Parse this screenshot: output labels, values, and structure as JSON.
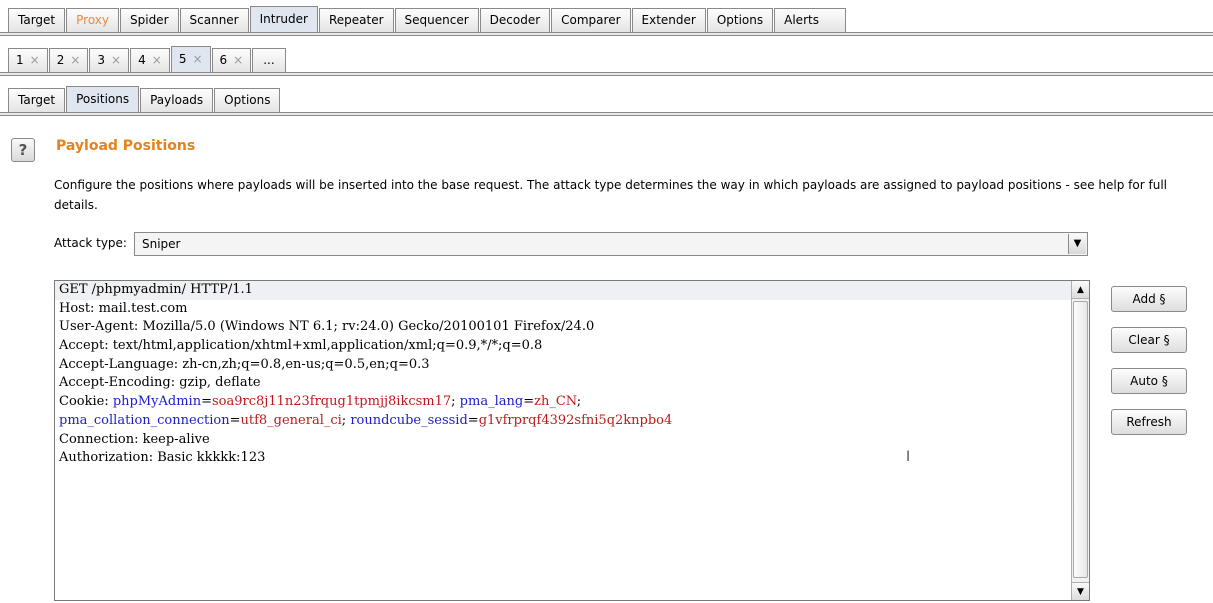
{
  "main_tabs": [
    {
      "label": "Target"
    },
    {
      "label": "Proxy"
    },
    {
      "label": "Spider"
    },
    {
      "label": "Scanner"
    },
    {
      "label": "Intruder"
    },
    {
      "label": "Repeater"
    },
    {
      "label": "Sequencer"
    },
    {
      "label": "Decoder"
    },
    {
      "label": "Comparer"
    },
    {
      "label": "Extender"
    },
    {
      "label": "Options"
    },
    {
      "label": "Alerts"
    }
  ],
  "attack_tabs": [
    {
      "label": "1",
      "close": "×"
    },
    {
      "label": "2",
      "close": "×"
    },
    {
      "label": "3",
      "close": "×"
    },
    {
      "label": "4",
      "close": "×"
    },
    {
      "label": "5",
      "close": "×"
    },
    {
      "label": "6",
      "close": "×"
    },
    {
      "label": "..."
    }
  ],
  "sub_tabs": [
    {
      "label": "Target"
    },
    {
      "label": "Positions"
    },
    {
      "label": "Payloads"
    },
    {
      "label": "Options"
    }
  ],
  "help_icon": "?",
  "section": {
    "title": "Payload Positions",
    "description": "Configure the positions where payloads will be inserted into the base request. The attack type determines the way in which payloads are assigned to payload positions - see help for full details."
  },
  "attack_type": {
    "label": "Attack type:",
    "value": "Sniper"
  },
  "request": {
    "line1": "GET /phpmyadmin/ HTTP/1.1",
    "line2": "Host: mail.test.com",
    "line3": "User-Agent: Mozilla/5.0 (Windows NT 6.1; rv:24.0) Gecko/20100101 Firefox/24.0",
    "line4": "Accept: text/html,application/xhtml+xml,application/xml;q=0.9,*/*;q=0.8",
    "line5": "Accept-Language: zh-cn,zh;q=0.8,en-us;q=0.5,en;q=0.3",
    "line6": "Accept-Encoding: gzip, deflate",
    "cookie_prefix": "Cookie: ",
    "cookie1_name": "phpMyAdmin",
    "cookie1_value": "soa9rc8j11n23frqug1tpmjj8ikcsm17",
    "cookie2_name": "pma_lang",
    "cookie2_value": "zh_CN",
    "cookie3_name": "pma_collation_connection",
    "cookie3_value": "utf8_general_ci",
    "cookie4_name": "roundcube_sessid",
    "cookie4_value": "g1vfrprqf4392sfni5q2knpbo4",
    "line9": "Connection: keep-alive",
    "line10": "Authorization: Basic kkkkk:123"
  },
  "buttons": {
    "add": "Add §",
    "clear": "Clear §",
    "auto": "Auto §",
    "refresh": "Refresh"
  },
  "colors": {
    "accent": "#e5821d",
    "param_name": "#1c1cd0",
    "param_value": "#c01818"
  }
}
